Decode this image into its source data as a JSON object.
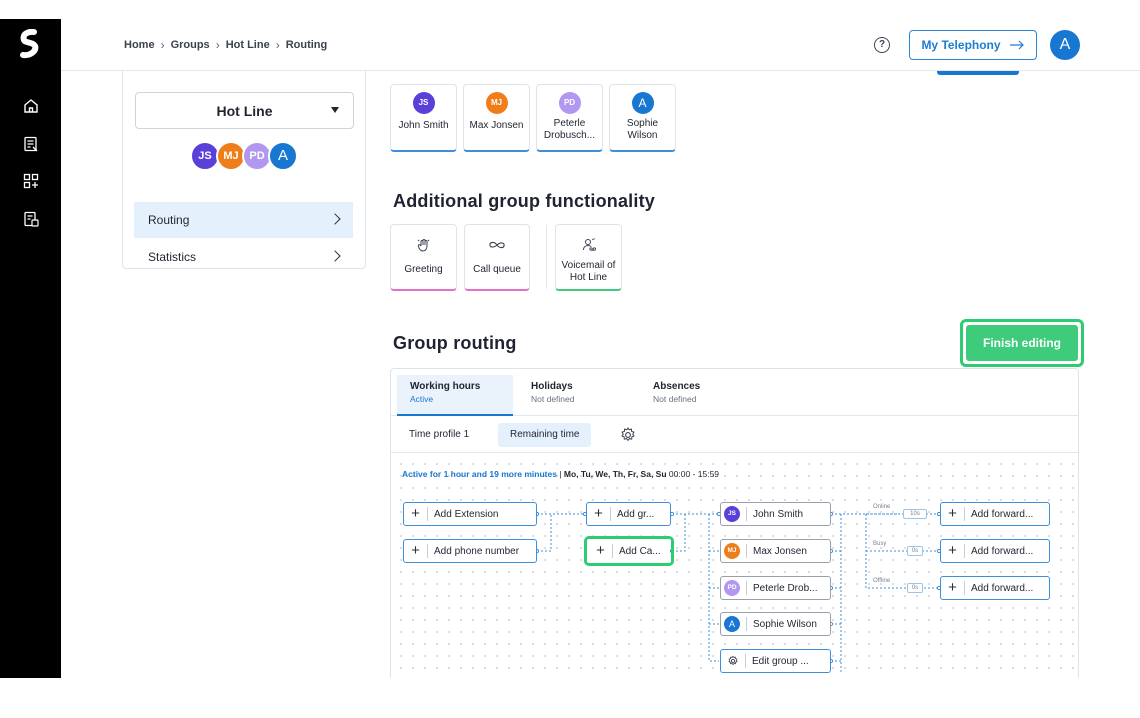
{
  "header": {
    "breadcrumb": [
      "Home",
      "Groups",
      "Hot Line",
      "Routing"
    ],
    "help_icon": "question-circle-icon",
    "telephony_button": "My Telephony",
    "user_initial": "A"
  },
  "sidebar": {
    "group_name": "Hot Line",
    "members": [
      {
        "initials": "JS",
        "color": "#5b3fd9"
      },
      {
        "initials": "MJ",
        "color": "#ef7d1a"
      },
      {
        "initials": "PD",
        "color": "#b197f0"
      },
      {
        "initials": "A",
        "color": "#1877d0"
      }
    ],
    "items": [
      {
        "label": "Routing",
        "active": true
      },
      {
        "label": "Statistics",
        "active": false
      }
    ]
  },
  "members": [
    {
      "initials": "JS",
      "name": "John Smith",
      "color": "#5b3fd9"
    },
    {
      "initials": "MJ",
      "name": "Max Jonsen",
      "color": "#ef7d1a"
    },
    {
      "initials": "PD",
      "name": "Peterle Drobusch...",
      "color": "#b197f0"
    },
    {
      "initials": "A",
      "name": "Sophie Wilson",
      "color": "#1877d0"
    }
  ],
  "functionality": {
    "title": "Additional group functionality",
    "items": [
      {
        "label": "Greeting",
        "icon": "hand-wave-icon",
        "accent": "#e570c8"
      },
      {
        "label": "Call queue",
        "icon": "infinity-icon",
        "accent": "#e570c8"
      },
      {
        "label": "Voicemail of Hot Line",
        "icon": "voicemail-user-icon",
        "accent": "#3fcb7c"
      }
    ]
  },
  "routing": {
    "title": "Group routing",
    "finish_button": "Finish editing",
    "tabs": [
      {
        "label": "Working hours",
        "status": "Active",
        "active": true
      },
      {
        "label": "Holidays",
        "status": "Not defined",
        "active": false
      },
      {
        "label": "Absences",
        "status": "Not defined",
        "active": false
      }
    ],
    "subtabs": [
      {
        "label": "Time profile 1",
        "active": false
      },
      {
        "label": "Remaining time",
        "active": true
      }
    ],
    "active_info": {
      "prefix": "Active for 1 hour and 19 more minutes",
      "divider": "|",
      "days": "Mo, Tu, We, Th, Fr, Sa, Su",
      "hours": "00:00 - 15:59"
    },
    "sources": [
      "Add Extension",
      "Add phone number"
    ],
    "middle": [
      "Add gr...",
      "Add Ca..."
    ],
    "targets": [
      {
        "initials": "JS",
        "name": "John Smith",
        "color": "#5b3fd9"
      },
      {
        "initials": "MJ",
        "name": "Max Jonsen",
        "color": "#ef7d1a"
      },
      {
        "initials": "PD",
        "name": "Peterle Drob...",
        "color": "#b197f0"
      },
      {
        "initials": "A",
        "name": "Sophie Wilson",
        "color": "#1877d0"
      }
    ],
    "edit_group": "Edit group ...",
    "forwards": [
      {
        "condition": "Online",
        "delay": "10s",
        "label": "Add forward..."
      },
      {
        "condition": "Busy",
        "delay": "0s",
        "label": "Add forward..."
      },
      {
        "condition": "Offline",
        "delay": "0s",
        "label": "Add forward..."
      }
    ]
  }
}
